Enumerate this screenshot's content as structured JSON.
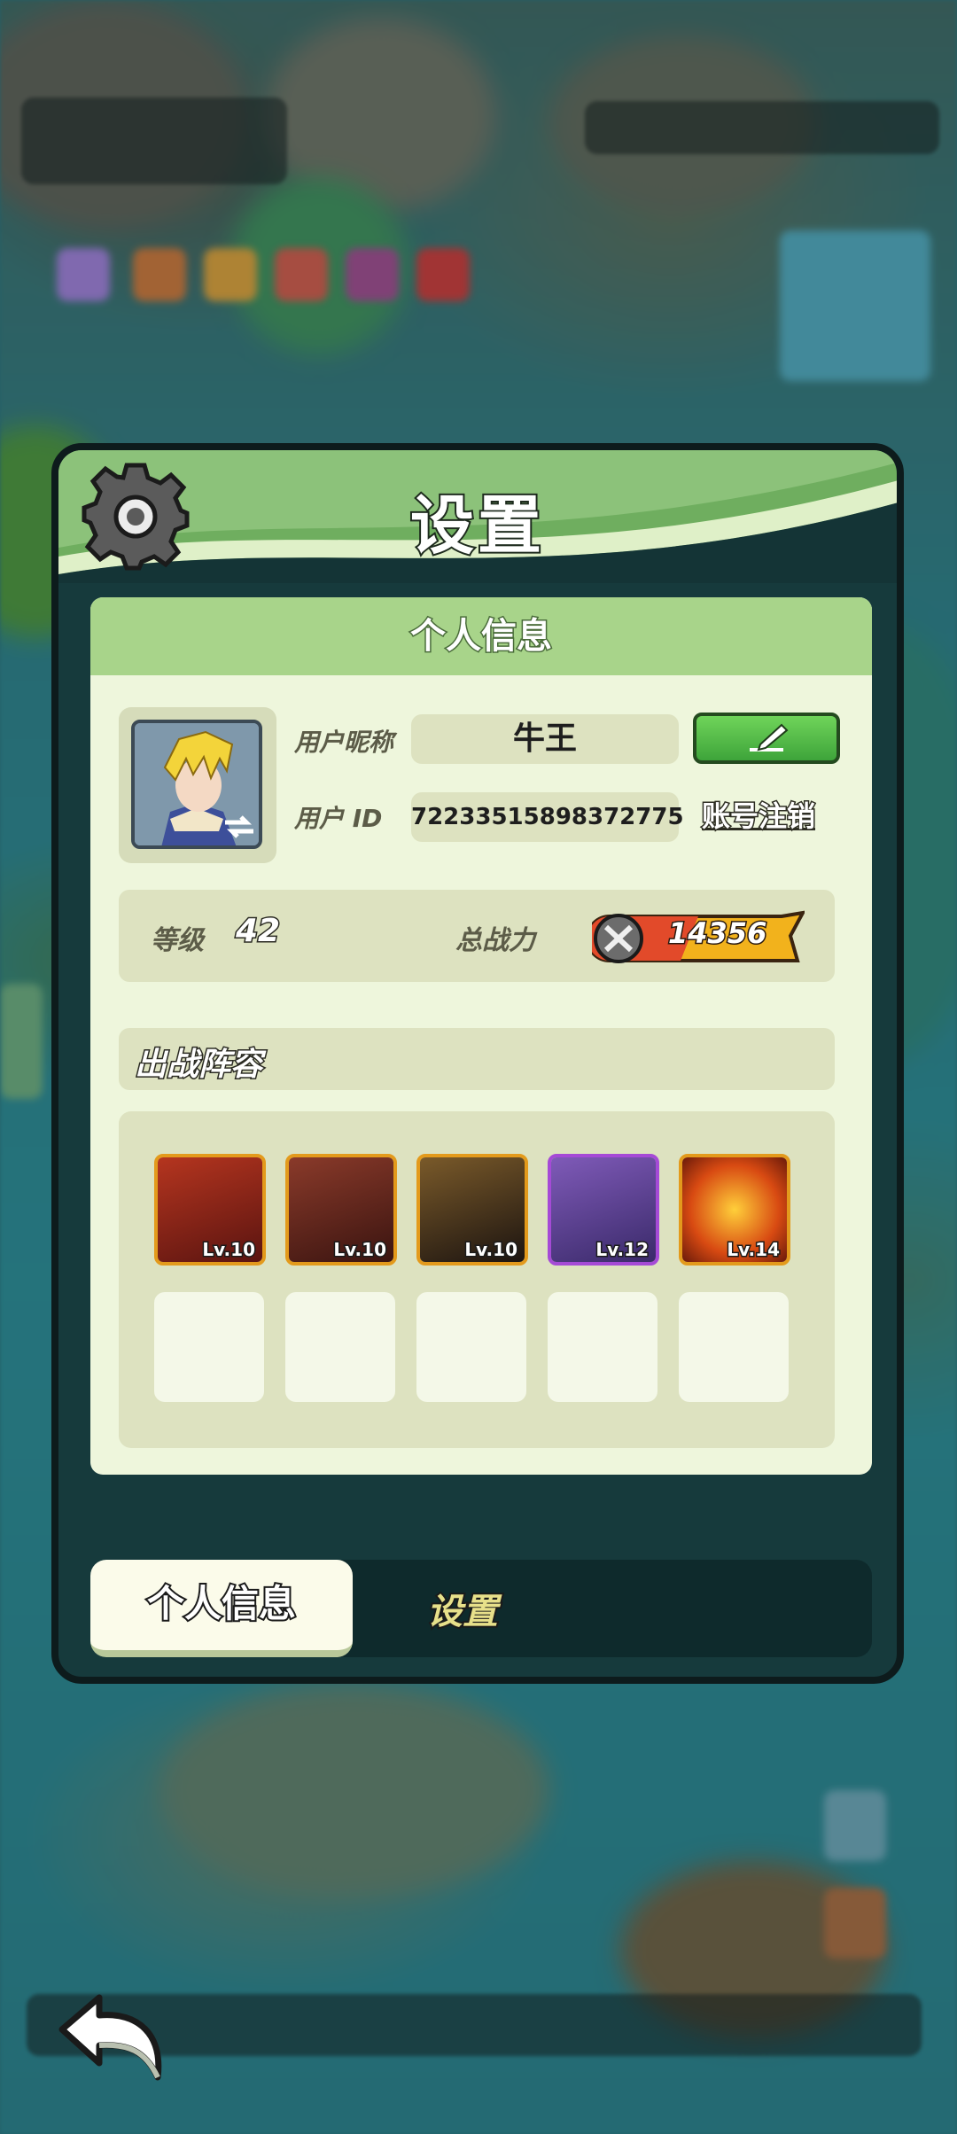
{
  "dialog": {
    "title": "设置",
    "section_title": "个人信息",
    "nickname_label": "用户昵称",
    "nickname_value": "牛王",
    "id_label": "用户  ID",
    "id_value": "72233515898372775",
    "logout_label": "账号注销",
    "level_label": "等级",
    "level_value": "42",
    "power_label": "总战力",
    "power_value": "14356",
    "lineup_title": "出战阵容"
  },
  "lineup": [
    {
      "level": "Lv.10",
      "frame": "#e39a1c",
      "bg": "#7a1e1a"
    },
    {
      "level": "Lv.10",
      "frame": "#e39a1c",
      "bg": "#6b2a22"
    },
    {
      "level": "Lv.10",
      "frame": "#e39a1c",
      "bg": "#3a2a1c"
    },
    {
      "level": "Lv.12",
      "frame": "#a54ad6",
      "bg": "#5a3a8a"
    },
    {
      "level": "Lv.14",
      "frame": "#e39a1c",
      "bg": "#b3361a"
    }
  ],
  "tabs": [
    {
      "label": "个人信息",
      "active": true
    },
    {
      "label": "设置",
      "active": false
    }
  ],
  "colors": {
    "header_green": "#6fae5f",
    "card_bg": "#eef6dc",
    "edit_green": "#4fb646"
  },
  "icons": [
    "gear-icon",
    "swap-icon",
    "edit-icon",
    "power-icon",
    "back-icon"
  ]
}
